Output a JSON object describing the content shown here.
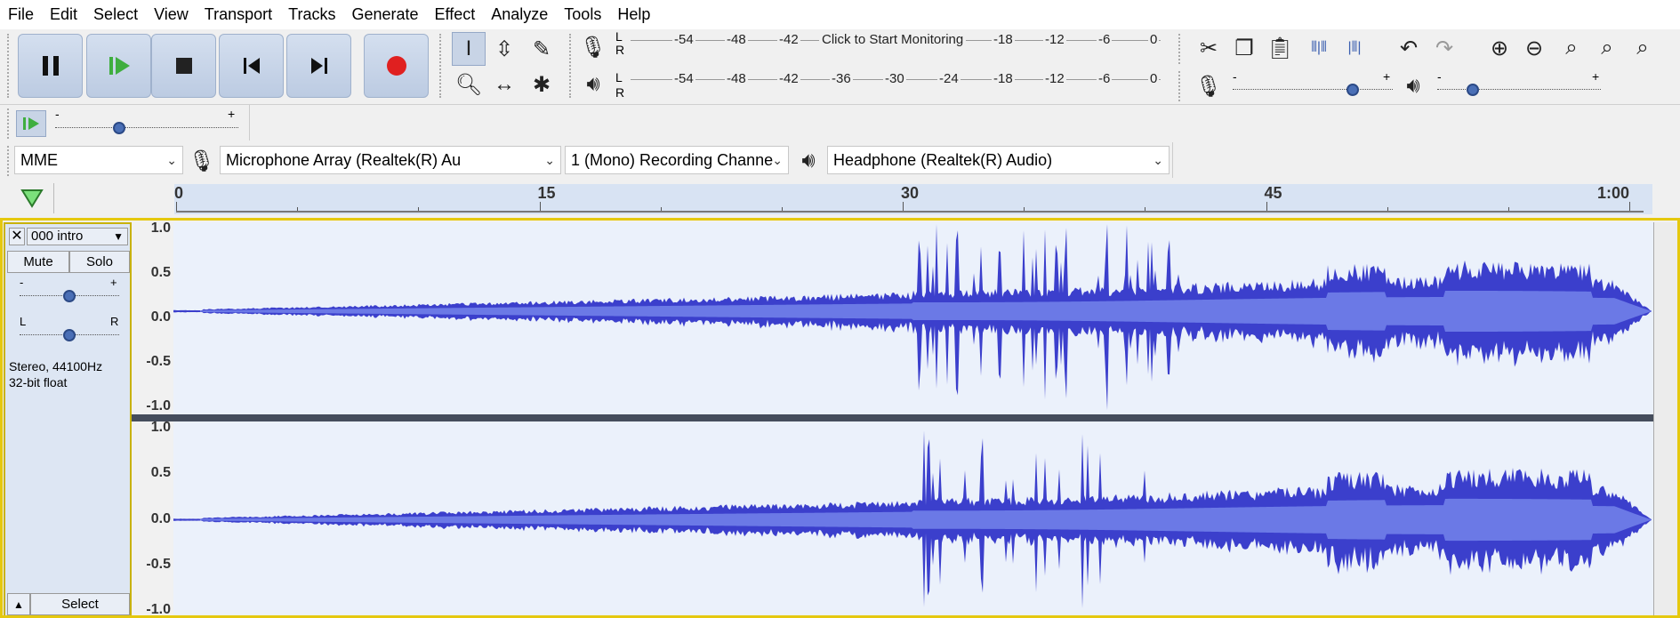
{
  "menu": [
    "File",
    "Edit",
    "Select",
    "View",
    "Transport",
    "Tracks",
    "Generate",
    "Effect",
    "Analyze",
    "Tools",
    "Help"
  ],
  "meters": {
    "record_ticks": [
      "-54",
      "-48",
      "-42",
      "-18",
      "-12",
      "-6",
      "0"
    ],
    "record_prompt": "Click to Start Monitoring",
    "playback_ticks": [
      "-54",
      "-48",
      "-42",
      "-36",
      "-30",
      "-24",
      "-18",
      "-12",
      "-6",
      "0"
    ],
    "channel_l": "L",
    "channel_r": "R"
  },
  "sliders": {
    "minus": "-",
    "plus": "+",
    "recording_volume": 0.75,
    "playback_volume": 0.22,
    "play_at_speed": 0.35
  },
  "devices": {
    "host": "MME",
    "recording_device": "Microphone Array (Realtek(R) Au",
    "channels": "1 (Mono) Recording Channе",
    "playback_device": "Headphone (Realtek(R) Audio)"
  },
  "timeline": {
    "labels": [
      "0",
      "15",
      "30",
      "45",
      "1:00"
    ],
    "seconds": [
      0,
      15,
      30,
      45,
      60
    ]
  },
  "track": {
    "name": "000 intro",
    "mute_label": "Mute",
    "solo_label": "Solo",
    "gain_minus": "-",
    "gain_plus": "+",
    "pan_left": "L",
    "pan_right": "R",
    "format_line1": "Stereo, 44100Hz",
    "format_line2": "32-bit float",
    "select_label": "Select",
    "gain_value": 0.5,
    "pan_value": 0.5,
    "y_ticks": [
      "1.0",
      "0.5",
      "0.0",
      "-0.5",
      "-1.0"
    ]
  },
  "colors": {
    "waveform": "#3b3fcc",
    "waveform_rms": "#6b79e6",
    "track_background": "#ebf1fb",
    "selection_border": "#e5c80e",
    "record_red": "#e02020",
    "play_green": "#3fae3f"
  }
}
